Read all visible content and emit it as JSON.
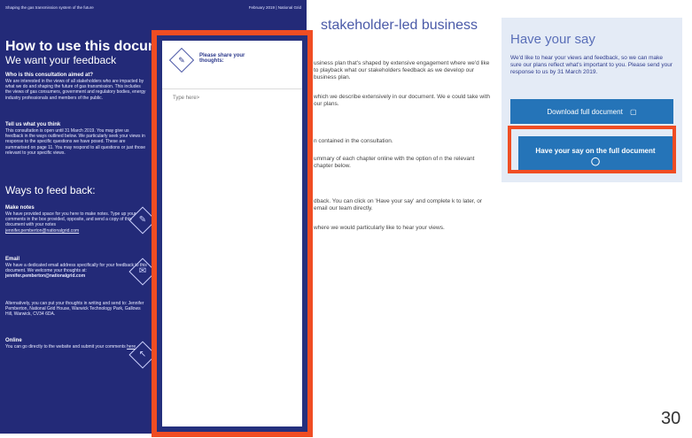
{
  "doc": {
    "header_left": "Shaping the gas transmission system of the future",
    "header_right": "February 2019 | National Grid",
    "title": "How to use this document",
    "subtitle": "We want your feedback",
    "sections": [
      {
        "title": "Who is this consultation aimed at?",
        "body": "We are interested in the views of all stakeholders who are impacted by what we do and shaping the future of gas transmission. This includes the views of gas consumers, government and regulatory bodies, energy industry professionals and members of the public."
      },
      {
        "title": "Tell us what you think",
        "body": "This consultation is open until 31 March 2019. You may give us feedback in the ways outlined below. We particularly seek your views in response to the specific questions we have posed. These are summarised on page 11. You may respond to all questions or just those relevant to your specific views."
      }
    ],
    "ways_title": "Ways to feed back:",
    "make_notes_title": "Make notes",
    "make_notes_body": "We have provided space for you here to make notes. Type up your comments in the box provided, opposite, and send a copy of this document with your notes",
    "make_notes_email": "jennifer.pemberton@nationalgrid.com",
    "email_title": "Email",
    "email_body": "We have a dedicated email address specifically for your feedback to this document. We welcome your thoughts at:",
    "email_address": "jennifer.pemberton@nationalgrid.com",
    "post_body": "Alternatively, you can put your thoughts in writing and send to: Jennifer Pemberton, National Grid House, Warwick Technology Park, Gallows Hill, Warwick, CV34 6DA.",
    "online_title": "Online",
    "online_body": "You can go directly to the website and submit your comments",
    "online_link": "here"
  },
  "notes": {
    "title": "Please share your thoughts:",
    "placeholder": "Type here>"
  },
  "web": {
    "heading": "stakeholder-led business",
    "paras": [
      "usiness plan that's shaped by extensive engagement where we'd like to playback what our stakeholders feedback as we develop our business plan.",
      "which we describe extensively in our document. We e could take with our plans.",
      "n contained in the consultation.",
      "ummary of each chapter online with the option of n the relevant chapter below.",
      "dback. You can click on 'Have your say' and complete k to later, or email our team directly.",
      "where we would particularly like to hear your views."
    ]
  },
  "card": {
    "title": "Have your say",
    "body": "We'd like to hear your views and feedback, so we can make sure our plans reflect what's important to you. Please send your response to us by 31 March 2019.",
    "download_label": "Download full document",
    "have_say_label": "Have your say on the full document"
  },
  "page_number": "30",
  "colors": {
    "navy": "#232a78",
    "highlight": "#f04d23",
    "button": "#2574b8"
  }
}
